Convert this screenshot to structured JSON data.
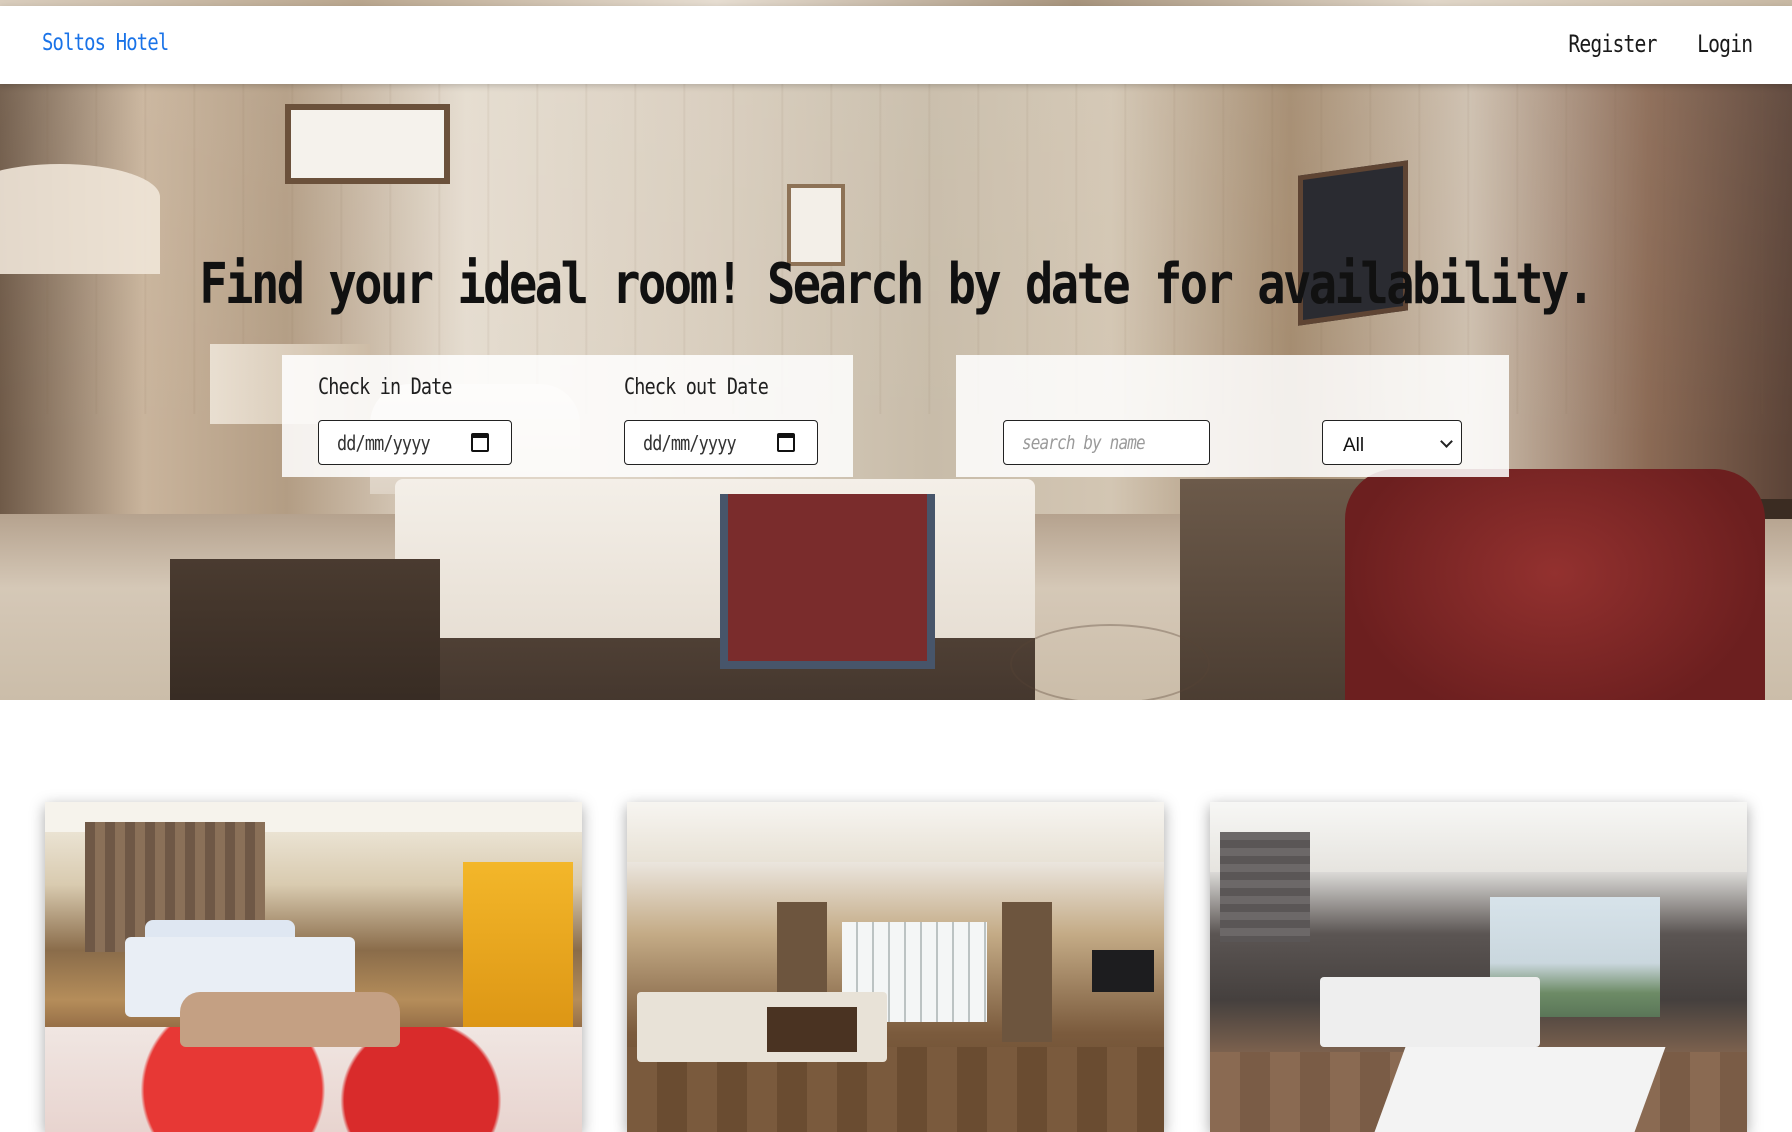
{
  "colors": {
    "brand": "#1a73e8",
    "panel_bg": "rgba(255,255,255,0.86)",
    "text_dark": "#111111"
  },
  "navbar": {
    "brand": "Soltos Hotel",
    "links": [
      {
        "label": "Register"
      },
      {
        "label": "Login"
      }
    ]
  },
  "hero": {
    "title": "Find your ideal room! Search by date for availability.",
    "check_in": {
      "label": "Check in Date",
      "placeholder": "dd/mm/yyyy",
      "icon": "calendar-icon"
    },
    "check_out": {
      "label": "Check out Date",
      "placeholder": "dd/mm/yyyy",
      "icon": "calendar-icon"
    },
    "search": {
      "placeholder": "search by name"
    },
    "filter": {
      "selected": "All",
      "icon": "chevron-down-icon"
    }
  }
}
